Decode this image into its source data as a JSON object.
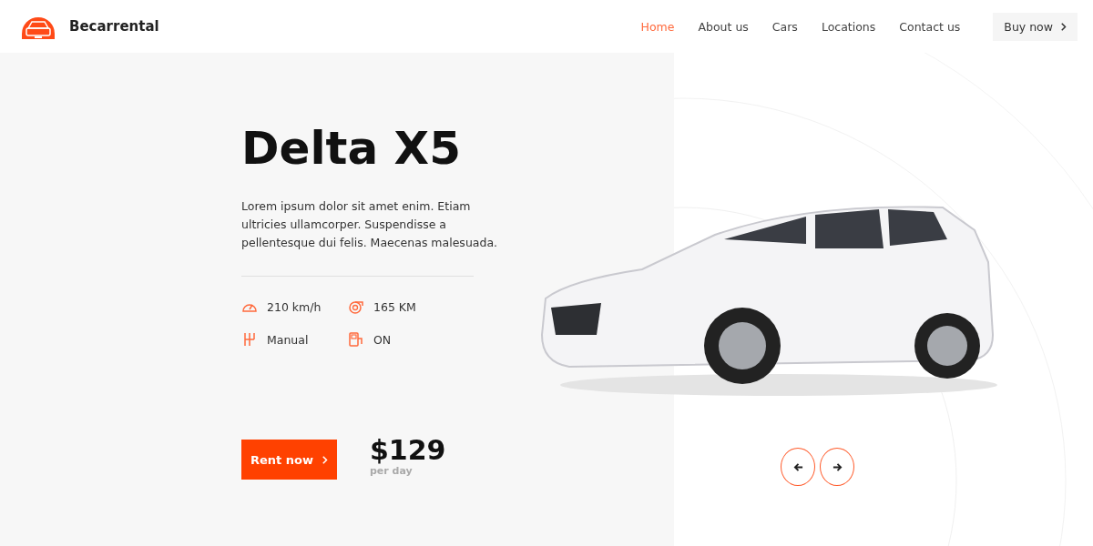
{
  "brand": {
    "name": "Becarrental"
  },
  "nav": [
    {
      "label": "Home",
      "selected": true
    },
    {
      "label": "About us",
      "selected": false
    },
    {
      "label": "Cars",
      "selected": false
    },
    {
      "label": "Locations",
      "selected": false
    },
    {
      "label": "Contact us",
      "selected": false
    }
  ],
  "buy_button": {
    "label": "Buy now"
  },
  "hero": {
    "title": "Delta X5",
    "description": "Lorem ipsum dolor sit amet enim. Etiam ultricies ullamcorper. Suspendisse a pellentesque dui felis. Maecenas malesuada.",
    "specs": [
      {
        "kind": "speed",
        "value": "210 km/h"
      },
      {
        "kind": "engine",
        "value": "165 KM"
      },
      {
        "kind": "gearbox",
        "value": "Manual"
      },
      {
        "kind": "fuel",
        "value": "ON"
      }
    ],
    "rent_button": {
      "label": "Rent now"
    },
    "price": "$129",
    "price_unit": "per day"
  }
}
